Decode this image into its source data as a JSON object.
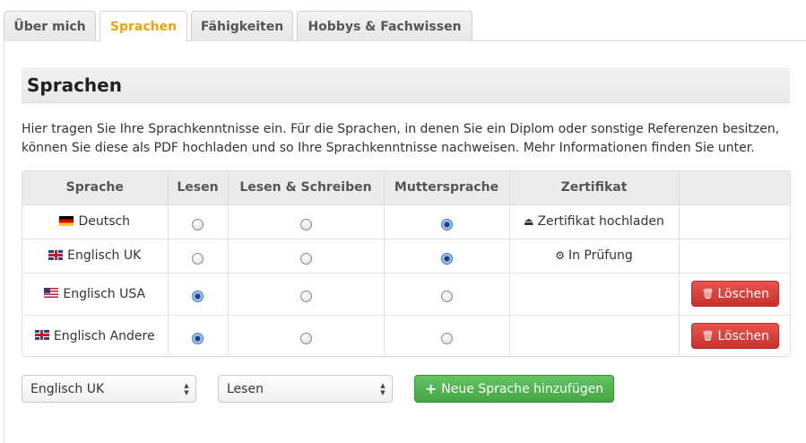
{
  "tabs": [
    {
      "label": "Über mich"
    },
    {
      "label": "Sprachen"
    },
    {
      "label": "Fähigkeiten"
    },
    {
      "label": "Hobbys & Fachwissen"
    }
  ],
  "active_tab": "Sprachen",
  "accent_color": "#e8a317",
  "section": {
    "title": "Sprachen",
    "intro_line1": "Hier tragen Sie Ihre Sprachkenntnisse ein. Für die Sprachen, in denen Sie ein Diplom oder sonstige Referenzen besitzen,",
    "intro_line2": "können Sie diese als PDF hochladen und so Ihre Sprachkenntnisse nachweisen. Mehr Informationen finden Sie unter."
  },
  "table": {
    "headers": [
      "Sprache",
      "Lesen",
      "Lesen & Schreiben",
      "Muttersprache",
      "Zertifikat",
      ""
    ],
    "rows": [
      {
        "flag": "de-flag-icon",
        "language": "Deutsch",
        "selected_level": "Muttersprache",
        "certificate": {
          "icon": "upload-inbox-icon",
          "text": "Zertifikat hochladen"
        },
        "action": ""
      },
      {
        "flag": "uk-flag-icon",
        "language": "Englisch UK",
        "selected_level": "Muttersprache",
        "certificate": {
          "icon": "gear-icon",
          "text": "In Prüfung"
        },
        "action": ""
      },
      {
        "flag": "us-flag-icon",
        "language": "Englisch USA",
        "selected_level": "Lesen",
        "certificate": null,
        "action": "Löschen"
      },
      {
        "flag": "uk-flag-icon",
        "language": "Englisch Andere",
        "selected_level": "Lesen",
        "certificate": null,
        "action": "Löschen"
      }
    ]
  },
  "delete_button_color": "#d9534f",
  "controls": {
    "language_select_value": "Englisch UK",
    "level_select_value": "Lesen",
    "add_button_label": "Neue Sprache hinzufügen",
    "add_button_color": "#51b351"
  }
}
